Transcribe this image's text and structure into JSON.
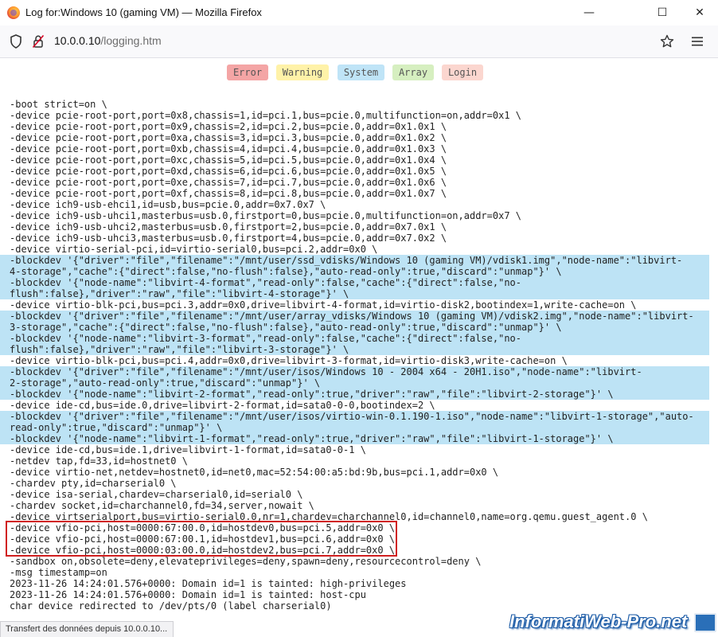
{
  "window": {
    "title": "Log for:Windows 10 (gaming VM) — Mozilla Firefox",
    "minimize": "—",
    "maximize": "☐",
    "close": "✕"
  },
  "navbar": {
    "url_host": "10.0.0.10",
    "url_path": "/logging.htm"
  },
  "filters": [
    {
      "label": "Error",
      "color": "#f4a5a5"
    },
    {
      "label": "Warning",
      "color": "#fff2a8"
    },
    {
      "label": "System",
      "color": "#bfe4f7"
    },
    {
      "label": "Array",
      "color": "#d6efc0"
    },
    {
      "label": "Login",
      "color": "#fbd6cf"
    }
  ],
  "log_lines": [
    {
      "text": "-boot strict=on \\",
      "hl": false
    },
    {
      "text": "-device pcie-root-port,port=0x8,chassis=1,id=pci.1,bus=pcie.0,multifunction=on,addr=0x1 \\",
      "hl": false
    },
    {
      "text": "-device pcie-root-port,port=0x9,chassis=2,id=pci.2,bus=pcie.0,addr=0x1.0x1 \\",
      "hl": false
    },
    {
      "text": "-device pcie-root-port,port=0xa,chassis=3,id=pci.3,bus=pcie.0,addr=0x1.0x2 \\",
      "hl": false
    },
    {
      "text": "-device pcie-root-port,port=0xb,chassis=4,id=pci.4,bus=pcie.0,addr=0x1.0x3 \\",
      "hl": false
    },
    {
      "text": "-device pcie-root-port,port=0xc,chassis=5,id=pci.5,bus=pcie.0,addr=0x1.0x4 \\",
      "hl": false
    },
    {
      "text": "-device pcie-root-port,port=0xd,chassis=6,id=pci.6,bus=pcie.0,addr=0x1.0x5 \\",
      "hl": false
    },
    {
      "text": "-device pcie-root-port,port=0xe,chassis=7,id=pci.7,bus=pcie.0,addr=0x1.0x6 \\",
      "hl": false
    },
    {
      "text": "-device pcie-root-port,port=0xf,chassis=8,id=pci.8,bus=pcie.0,addr=0x1.0x7 \\",
      "hl": false
    },
    {
      "text": "-device ich9-usb-ehci1,id=usb,bus=pcie.0,addr=0x7.0x7 \\",
      "hl": false
    },
    {
      "text": "-device ich9-usb-uhci1,masterbus=usb.0,firstport=0,bus=pcie.0,multifunction=on,addr=0x7 \\",
      "hl": false
    },
    {
      "text": "-device ich9-usb-uhci2,masterbus=usb.0,firstport=2,bus=pcie.0,addr=0x7.0x1 \\",
      "hl": false
    },
    {
      "text": "-device ich9-usb-uhci3,masterbus=usb.0,firstport=4,bus=pcie.0,addr=0x7.0x2 \\",
      "hl": false
    },
    {
      "text": "-device virtio-serial-pci,id=virtio-serial0,bus=pci.2,addr=0x0 \\",
      "hl": false
    },
    {
      "text": "-blockdev '{\"driver\":\"file\",\"filename\":\"/mnt/user/ssd_vdisks/Windows 10 (gaming VM)/vdisk1.img\",\"node-name\":\"libvirt-",
      "hl": true
    },
    {
      "text": "4-storage\",\"cache\":{\"direct\":false,\"no-flush\":false},\"auto-read-only\":true,\"discard\":\"unmap\"}' \\",
      "hl": true
    },
    {
      "text": "-blockdev '{\"node-name\":\"libvirt-4-format\",\"read-only\":false,\"cache\":{\"direct\":false,\"no-",
      "hl": true
    },
    {
      "text": "flush\":false},\"driver\":\"raw\",\"file\":\"libvirt-4-storage\"}' \\",
      "hl": true
    },
    {
      "text": "-device virtio-blk-pci,bus=pci.3,addr=0x0,drive=libvirt-4-format,id=virtio-disk2,bootindex=1,write-cache=on \\",
      "hl": false
    },
    {
      "text": "-blockdev '{\"driver\":\"file\",\"filename\":\"/mnt/user/array_vdisks/Windows 10 (gaming VM)/vdisk2.img\",\"node-name\":\"libvirt-",
      "hl": true
    },
    {
      "text": "3-storage\",\"cache\":{\"direct\":false,\"no-flush\":false},\"auto-read-only\":true,\"discard\":\"unmap\"}' \\",
      "hl": true
    },
    {
      "text": "-blockdev '{\"node-name\":\"libvirt-3-format\",\"read-only\":false,\"cache\":{\"direct\":false,\"no-",
      "hl": true
    },
    {
      "text": "flush\":false},\"driver\":\"raw\",\"file\":\"libvirt-3-storage\"}' \\",
      "hl": true
    },
    {
      "text": "-device virtio-blk-pci,bus=pci.4,addr=0x0,drive=libvirt-3-format,id=virtio-disk3,write-cache=on \\",
      "hl": false
    },
    {
      "text": "-blockdev '{\"driver\":\"file\",\"filename\":\"/mnt/user/isos/Windows 10 - 2004 x64 - 20H1.iso\",\"node-name\":\"libvirt-",
      "hl": true
    },
    {
      "text": "2-storage\",\"auto-read-only\":true,\"discard\":\"unmap\"}' \\",
      "hl": true
    },
    {
      "text": "-blockdev '{\"node-name\":\"libvirt-2-format\",\"read-only\":true,\"driver\":\"raw\",\"file\":\"libvirt-2-storage\"}' \\",
      "hl": true
    },
    {
      "text": "-device ide-cd,bus=ide.0,drive=libvirt-2-format,id=sata0-0-0,bootindex=2 \\",
      "hl": false
    },
    {
      "text": "-blockdev '{\"driver\":\"file\",\"filename\":\"/mnt/user/isos/virtio-win-0.1.190-1.iso\",\"node-name\":\"libvirt-1-storage\",\"auto-",
      "hl": true
    },
    {
      "text": "read-only\":true,\"discard\":\"unmap\"}' \\",
      "hl": true
    },
    {
      "text": "-blockdev '{\"node-name\":\"libvirt-1-format\",\"read-only\":true,\"driver\":\"raw\",\"file\":\"libvirt-1-storage\"}' \\",
      "hl": true
    },
    {
      "text": "-device ide-cd,bus=ide.1,drive=libvirt-1-format,id=sata0-0-1 \\",
      "hl": false
    },
    {
      "text": "-netdev tap,fd=33,id=hostnet0 \\",
      "hl": false
    },
    {
      "text": "-device virtio-net,netdev=hostnet0,id=net0,mac=52:54:00:a5:bd:9b,bus=pci.1,addr=0x0 \\",
      "hl": false
    },
    {
      "text": "-chardev pty,id=charserial0 \\",
      "hl": false
    },
    {
      "text": "-device isa-serial,chardev=charserial0,id=serial0 \\",
      "hl": false
    },
    {
      "text": "-chardev socket,id=charchannel0,fd=34,server,nowait \\",
      "hl": false
    },
    {
      "text": "-device virtserialport,bus=virtio-serial0.0,nr=1,chardev=charchannel0,id=channel0,name=org.qemu.guest_agent.0 \\",
      "hl": false
    },
    {
      "text": "-device vfio-pci,host=0000:67:00.0,id=hostdev0,bus=pci.5,addr=0x0 \\",
      "hl": false
    },
    {
      "text": "-device vfio-pci,host=0000:67:00.1,id=hostdev1,bus=pci.6,addr=0x0 \\",
      "hl": false
    },
    {
      "text": "-device vfio-pci,host=0000:03:00.0,id=hostdev2,bus=pci.7,addr=0x0 \\",
      "hl": false
    },
    {
      "text": "-sandbox on,obsolete=deny,elevateprivileges=deny,spawn=deny,resourcecontrol=deny \\",
      "hl": false
    },
    {
      "text": "-msg timestamp=on",
      "hl": false
    },
    {
      "text": "2023-11-26 14:24:01.576+0000: Domain id=1 is tainted: high-privileges",
      "hl": false
    },
    {
      "text": "2023-11-26 14:24:01.576+0000: Domain id=1 is tainted: host-cpu",
      "hl": false
    },
    {
      "text": "char device redirected to /dev/pts/0 (label charserial0)",
      "hl": false
    }
  ],
  "status_text": "Transfert des données depuis 10.0.0.10...",
  "watermark": "InformatiWeb-Pro.net"
}
